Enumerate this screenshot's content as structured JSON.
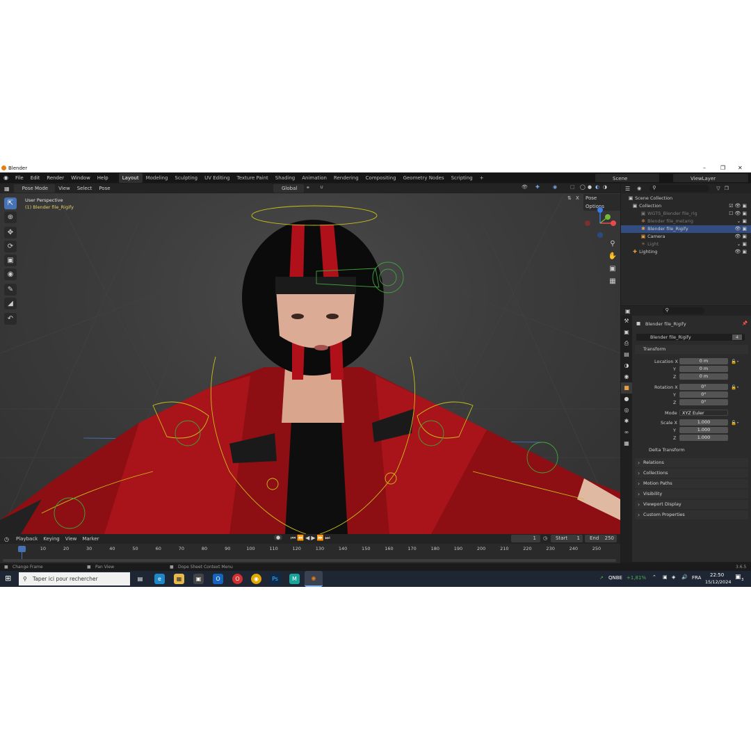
{
  "window": {
    "title": "Blender"
  },
  "menu": {
    "file": "File",
    "edit": "Edit",
    "render": "Render",
    "window": "Window",
    "help": "Help"
  },
  "workspaces": [
    "Layout",
    "Modeling",
    "Sculpting",
    "UV Editing",
    "Texture Paint",
    "Shading",
    "Animation",
    "Rendering",
    "Compositing",
    "Geometry Nodes",
    "Scripting"
  ],
  "scene": {
    "label": "Scene",
    "viewlayer": "ViewLayer"
  },
  "viewport": {
    "mode": "Pose Mode",
    "view": "View",
    "select": "Select",
    "pose": "Pose",
    "orientation": "Global",
    "pose_options": "Pose Options",
    "overlay_title": "User Perspective",
    "overlay_object": "(1) Blender file_Rigify"
  },
  "outliner": {
    "scene_collection": "Scene Collection",
    "items": [
      {
        "label": "Collection"
      },
      {
        "label": "WGTS_Blender file_rig"
      },
      {
        "label": "Blender file_metarig"
      },
      {
        "label": "Blender file_Rigify"
      },
      {
        "label": "Camera"
      },
      {
        "label": "Light"
      },
      {
        "label": "Lighting"
      }
    ]
  },
  "properties": {
    "object_name": "Blender file_Rigify",
    "data_name": "Blender file_Rigify",
    "users": "4",
    "transform": "Transform",
    "location_label": "Location X",
    "loc": [
      "0 m",
      "0 m",
      "0 m"
    ],
    "rotation_label": "Rotation X",
    "rot": [
      "0°",
      "0°",
      "0°"
    ],
    "mode_label": "Mode",
    "mode_value": "XYZ Euler",
    "scale_label": "Scale X",
    "scale": [
      "1.000",
      "1.000",
      "1.000"
    ],
    "y": "Y",
    "z": "Z",
    "sections": [
      "Delta Transform",
      "Relations",
      "Collections",
      "Motion Paths",
      "Visibility",
      "Viewport Display",
      "Custom Properties"
    ]
  },
  "timeline": {
    "playback": "Playback",
    "keying": "Keying",
    "view": "View",
    "marker": "Marker",
    "current": "1",
    "start_label": "Start",
    "start": "1",
    "end_label": "End",
    "end": "250",
    "ticks": [
      "1",
      "10",
      "20",
      "30",
      "40",
      "50",
      "60",
      "70",
      "80",
      "90",
      "100",
      "110",
      "120",
      "130",
      "140",
      "150",
      "160",
      "170",
      "180",
      "190",
      "200",
      "210",
      "220",
      "230",
      "240",
      "250"
    ]
  },
  "status": {
    "left": "Change Frame",
    "mid": "Pan View",
    "right": "Dope Sheet Context Menu",
    "version": "3.6.5"
  },
  "taskbar": {
    "search_placeholder": "Taper ici pour rechercher",
    "stock": "QNBE",
    "stock_change": "+1,81%",
    "lang": "FRA",
    "time": "22:50",
    "date": "15/12/2024",
    "notif": "3"
  }
}
